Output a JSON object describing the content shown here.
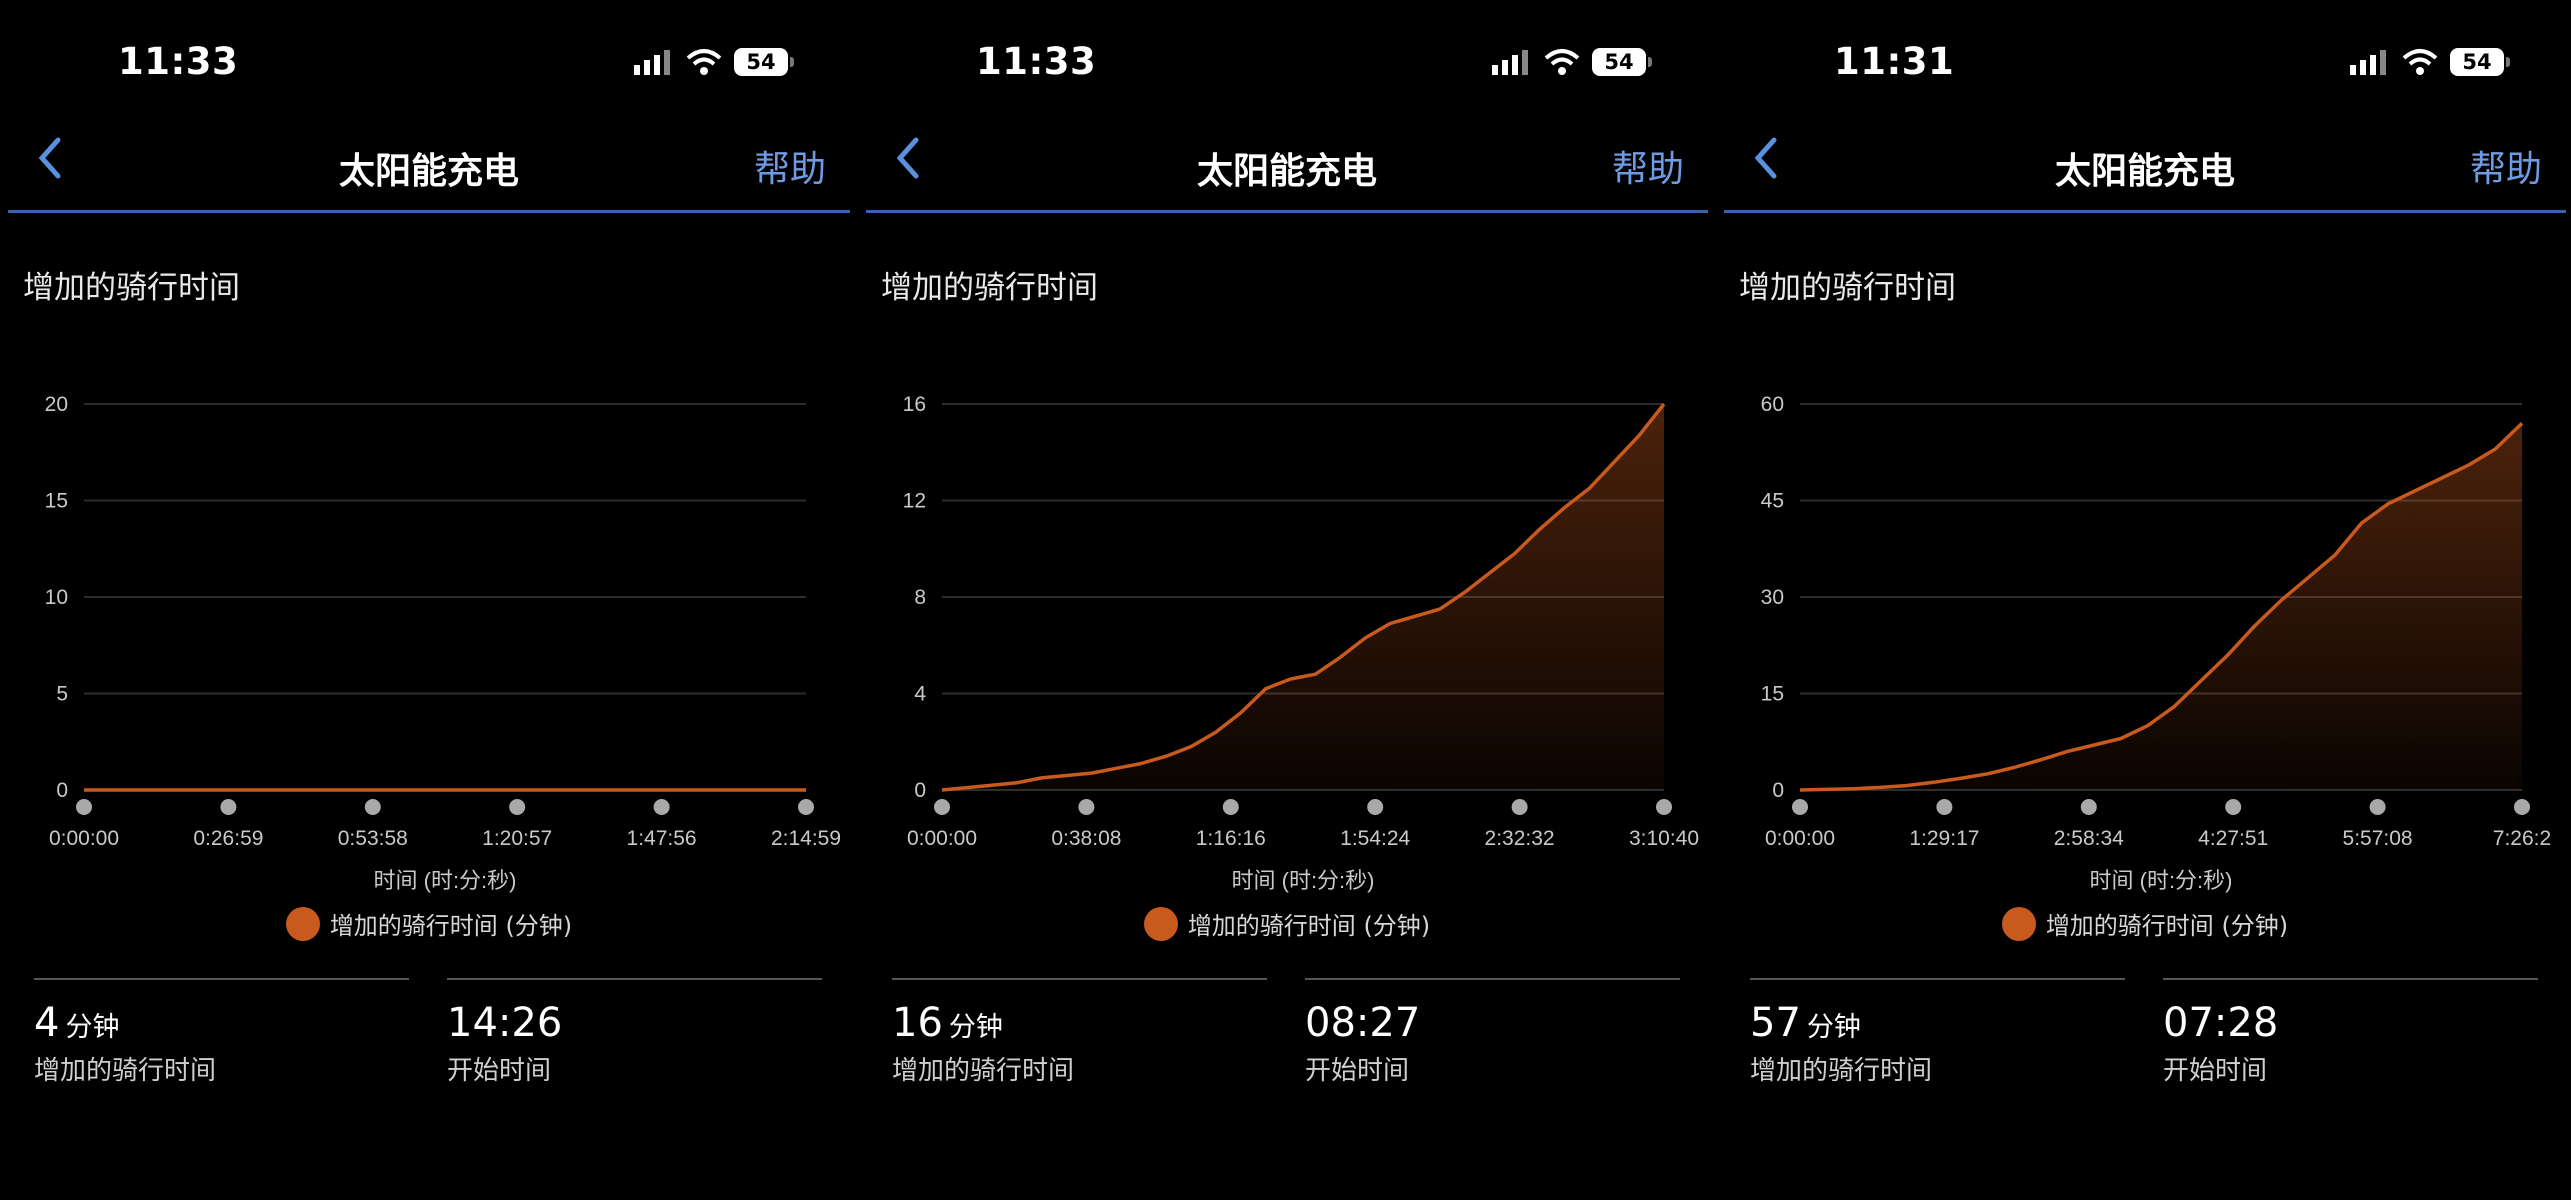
{
  "screens": [
    {
      "status_time": "11:33",
      "battery": "54",
      "nav": {
        "title": "太阳能充电",
        "help": "帮助"
      },
      "section_title": "增加的骑行时间",
      "legend": "增加的骑行时间 (分钟)",
      "stats": [
        {
          "value": "4",
          "unit": "分钟",
          "label": "增加的骑行时间"
        },
        {
          "value": "14:26",
          "unit": "",
          "label": "开始时间"
        }
      ],
      "chart_data": {
        "type": "area",
        "xlabel": "时间 (时:分:秒)",
        "x_ticks": [
          "0:00:00",
          "0:26:59",
          "0:53:58",
          "1:20:57",
          "1:47:56",
          "2:14:59"
        ],
        "y_ticks": [
          0,
          5,
          10,
          15,
          20
        ],
        "ylim": [
          0,
          20
        ],
        "series": [
          {
            "name": "增加的骑行时间 (分钟)",
            "values": [
              0,
              0,
              0,
              0,
              0,
              0
            ]
          }
        ],
        "color": "#c85a1e",
        "grid": true
      }
    },
    {
      "status_time": "11:33",
      "battery": "54",
      "nav": {
        "title": "太阳能充电",
        "help": "帮助"
      },
      "section_title": "增加的骑行时间",
      "legend": "增加的骑行时间 (分钟)",
      "stats": [
        {
          "value": "16",
          "unit": "分钟",
          "label": "增加的骑行时间"
        },
        {
          "value": "08:27",
          "unit": "",
          "label": "开始时间"
        }
      ],
      "chart_data": {
        "type": "area",
        "xlabel": "时间 (时:分:秒)",
        "x_ticks": [
          "0:00:00",
          "0:38:08",
          "1:16:16",
          "1:54:24",
          "2:32:32",
          "3:10:40"
        ],
        "y_ticks": [
          0,
          4,
          8,
          12,
          16
        ],
        "ylim": [
          0,
          16
        ],
        "series": [
          {
            "name": "增加的骑行时间 (分钟)",
            "values": [
              0,
              0.1,
              0.2,
              0.3,
              0.5,
              0.6,
              0.7,
              0.9,
              1.1,
              1.4,
              1.8,
              2.4,
              3.2,
              4.2,
              4.6,
              4.8,
              5.5,
              6.3,
              6.9,
              7.2,
              7.5,
              8.2,
              9.0,
              9.8,
              10.8,
              11.7,
              12.5,
              13.6,
              14.7,
              16.0
            ]
          }
        ],
        "color": "#c85a1e",
        "grid": true
      }
    },
    {
      "status_time": "11:31",
      "battery": "54",
      "nav": {
        "title": "太阳能充电",
        "help": "帮助"
      },
      "section_title": "增加的骑行时间",
      "legend": "增加的骑行时间 (分钟)",
      "stats": [
        {
          "value": "57",
          "unit": "分钟",
          "label": "增加的骑行时间"
        },
        {
          "value": "07:28",
          "unit": "",
          "label": "开始时间"
        }
      ],
      "chart_data": {
        "type": "area",
        "xlabel": "时间 (时:分:秒)",
        "x_ticks": [
          "0:00:00",
          "1:29:17",
          "2:58:34",
          "4:27:51",
          "5:57:08",
          "7:26:2"
        ],
        "y_ticks": [
          0,
          15,
          30,
          45,
          60
        ],
        "ylim": [
          0,
          60
        ],
        "series": [
          {
            "name": "增加的骑行时间 (分钟)",
            "values": [
              0,
              0.1,
              0.2,
              0.4,
              0.7,
              1.2,
              1.8,
              2.5,
              3.5,
              4.7,
              6.0,
              7.0,
              8.0,
              10.0,
              13.0,
              17.0,
              21.0,
              25.5,
              29.5,
              33.0,
              36.5,
              41.5,
              44.5,
              46.5,
              48.5,
              50.5,
              53.0,
              57.0
            ]
          }
        ],
        "color": "#c85a1e",
        "grid": true
      }
    }
  ]
}
